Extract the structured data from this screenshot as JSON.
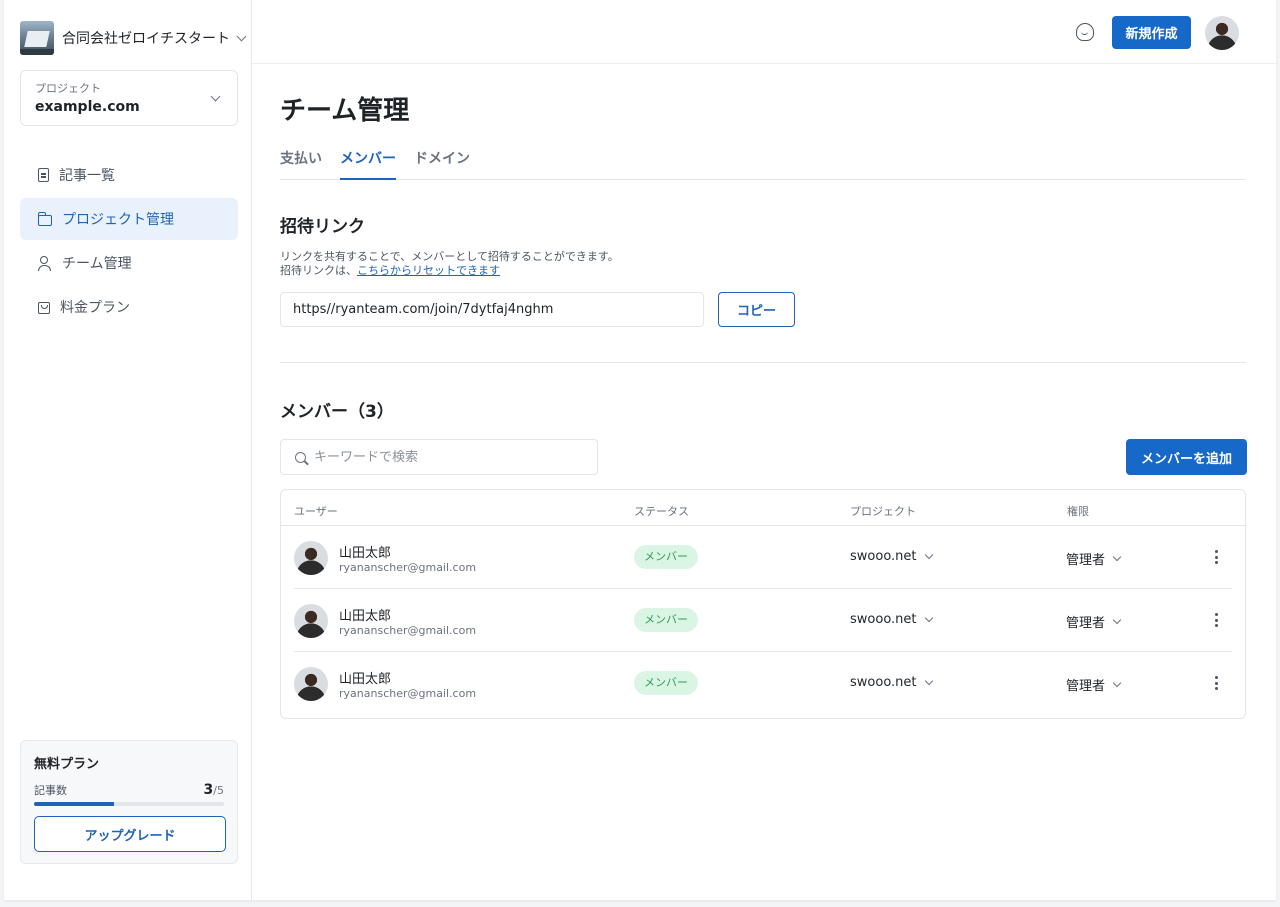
{
  "org": {
    "name": "合同会社ゼロイチスタート"
  },
  "project_select": {
    "label": "プロジェクト",
    "value": "example.com"
  },
  "sidebar": {
    "items": [
      {
        "label": "記事一覧",
        "icon": "document-icon"
      },
      {
        "label": "プロジェクト管理",
        "icon": "folder-icon",
        "active": true
      },
      {
        "label": "チーム管理",
        "icon": "users-icon"
      },
      {
        "label": "料金プラン",
        "icon": "bag-icon"
      }
    ]
  },
  "plan": {
    "title": "無料プラン",
    "usage_label": "記事数",
    "used": "3",
    "limit": "/5",
    "progress": 0.42,
    "upgrade_label": "アップグレード"
  },
  "header": {
    "new_label": "新規作成"
  },
  "page": {
    "title": "チーム管理"
  },
  "tabs": [
    {
      "label": "支払い"
    },
    {
      "label": "メンバー",
      "active": true
    },
    {
      "label": "ドメイン"
    }
  ],
  "invite": {
    "title": "招待リンク",
    "desc_line1": "リンクを共有することで、メンバーとして招待することができます。",
    "desc_line2_prefix": "招待リンクは、",
    "desc_line2_link": "こちらからリセットできます",
    "url": "https//ryanteam.com/join/7dytfaj4nghm",
    "copy_label": "コピー"
  },
  "members": {
    "title": "メンバー（3）",
    "search_placeholder": "キーワードで検索",
    "add_label": "メンバーを追加",
    "columns": [
      "ユーザー",
      "ステータス",
      "プロジェクト",
      "権限"
    ],
    "rows": [
      {
        "name": "山田太郎",
        "email": "ryananscher@gmail.com",
        "status": "メンバー",
        "project": "swooo.net",
        "role": "管理者"
      },
      {
        "name": "山田太郎",
        "email": "ryananscher@gmail.com",
        "status": "メンバー",
        "project": "swooo.net",
        "role": "管理者"
      },
      {
        "name": "山田太郎",
        "email": "ryananscher@gmail.com",
        "status": "メンバー",
        "project": "swooo.net",
        "role": "管理者"
      }
    ]
  },
  "colors": {
    "accent": "#1668c9",
    "active_bg": "#e8f1fc",
    "badge_bg": "#dbf5e4",
    "badge_text": "#2d9a5a"
  }
}
